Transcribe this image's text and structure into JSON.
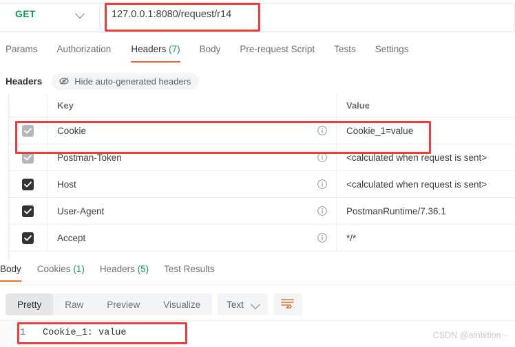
{
  "url_bar": {
    "method": "GET",
    "method_chevron_icon": "chevron-down-icon",
    "url_value": "127.0.0.1:8080/request/r14",
    "url_placeholder": "Enter URL or paste text"
  },
  "request_tabs": [
    {
      "label": "Params",
      "count": "",
      "active": false
    },
    {
      "label": "Authorization",
      "count": "",
      "active": false
    },
    {
      "label": "Headers",
      "count": " (7)",
      "active": true
    },
    {
      "label": "Body",
      "count": "",
      "active": false
    },
    {
      "label": "Pre-request Script",
      "count": "",
      "active": false
    },
    {
      "label": "Tests",
      "count": "",
      "active": false
    },
    {
      "label": "Settings",
      "count": "",
      "active": false
    }
  ],
  "headers_section": {
    "title": "Headers",
    "hide_auto_label": "Hide auto-generated headers",
    "hide_auto_icon": "eye-slash-icon",
    "columns": {
      "key": "Key",
      "value": "Value"
    },
    "rows": [
      {
        "checked": true,
        "disabled": true,
        "key": "Cookie",
        "value": "Cookie_1=value",
        "info_icon": "info-circle-icon"
      },
      {
        "checked": true,
        "disabled": true,
        "key": "Postman-Token",
        "value": "<calculated when request is sent>",
        "info_icon": "info-circle-icon"
      },
      {
        "checked": true,
        "disabled": false,
        "key": "Host",
        "value": "<calculated when request is sent>",
        "info_icon": "info-circle-icon"
      },
      {
        "checked": true,
        "disabled": false,
        "key": "User-Agent",
        "value": "PostmanRuntime/7.36.1",
        "info_icon": "info-circle-icon"
      },
      {
        "checked": true,
        "disabled": false,
        "key": "Accept",
        "value": "*/*",
        "info_icon": "info-circle-icon"
      }
    ]
  },
  "response_tabs": [
    {
      "label": "Body",
      "count": "",
      "active": true
    },
    {
      "label": "Cookies",
      "count": " (1)",
      "active": false
    },
    {
      "label": "Headers",
      "count": " (5)",
      "active": false
    },
    {
      "label": "Test Results",
      "count": "",
      "active": false
    }
  ],
  "view_toolbar": {
    "modes": [
      {
        "label": "Pretty",
        "active": true
      },
      {
        "label": "Raw",
        "active": false
      },
      {
        "label": "Preview",
        "active": false
      },
      {
        "label": "Visualize",
        "active": false
      }
    ],
    "format_label": "Text",
    "format_chevron_icon": "chevron-down-icon",
    "wrap_icon": "word-wrap-icon"
  },
  "body_viewer": {
    "line_number": "1",
    "line_text": "Cookie_1: value"
  },
  "watermark": "CSDN @ambition···",
  "colors": {
    "method_green": "#0d9a55",
    "accent_orange": "#ef6c2d",
    "annotation_red": "#ef3b3b",
    "count_green": "#0d9a55",
    "text_primary": "#2f3437",
    "text_muted": "#6b7177"
  }
}
